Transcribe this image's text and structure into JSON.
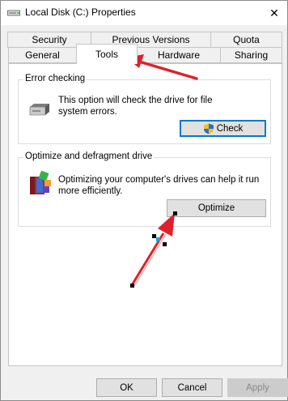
{
  "window": {
    "title": "Local Disk (C:) Properties",
    "close_glyph": "✕"
  },
  "tabs": {
    "top": [
      "Security",
      "Previous Versions",
      "Quota"
    ],
    "bottom": [
      "General",
      "Tools",
      "Hardware",
      "Sharing"
    ],
    "active": "Tools"
  },
  "error_checking": {
    "label": "Error checking",
    "description_line1": "This option will check the drive for file",
    "description_line2": "system errors.",
    "button": "Check",
    "icon": "drive-icon"
  },
  "optimize": {
    "label": "Optimize and defragment drive",
    "description_line1": "Optimizing your computer's drives can help it run",
    "description_line2": "more efficiently.",
    "button": "Optimize",
    "icon": "defrag-icon"
  },
  "footer": {
    "ok": "OK",
    "cancel": "Cancel",
    "apply": "Apply"
  },
  "annotation_color": "#e0202a"
}
